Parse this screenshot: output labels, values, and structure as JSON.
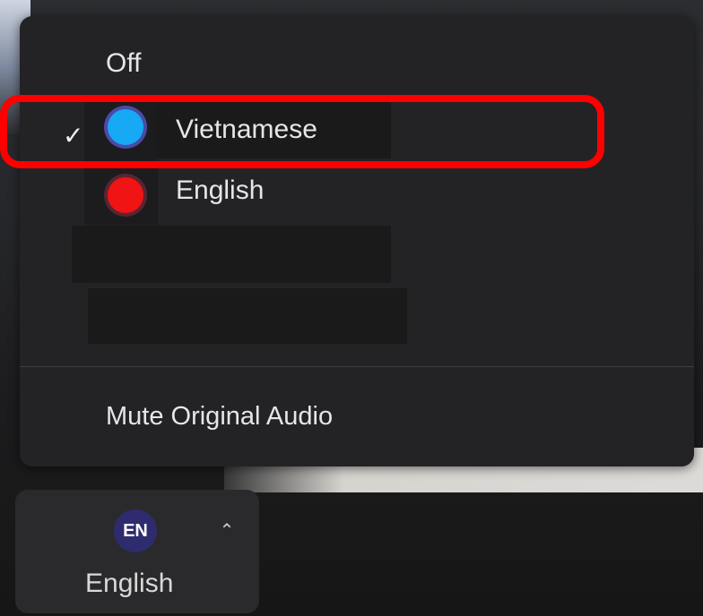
{
  "menu": {
    "items": [
      {
        "label": "Off",
        "checked": false
      },
      {
        "label": "Vietnamese",
        "checked": true,
        "dot_color": "#17a9f4"
      },
      {
        "label": "English",
        "checked": false,
        "dot_color": "#f01414"
      }
    ],
    "mute_label": "Mute Original Audio"
  },
  "language_button": {
    "badge": "EN",
    "label": "English"
  },
  "colors": {
    "highlight": "#ff0000",
    "menu_bg": "#232325",
    "badge_bg": "#2e2b6e"
  },
  "icons": {
    "check": "checkmark-icon",
    "chevron": "chevron-up-icon"
  }
}
